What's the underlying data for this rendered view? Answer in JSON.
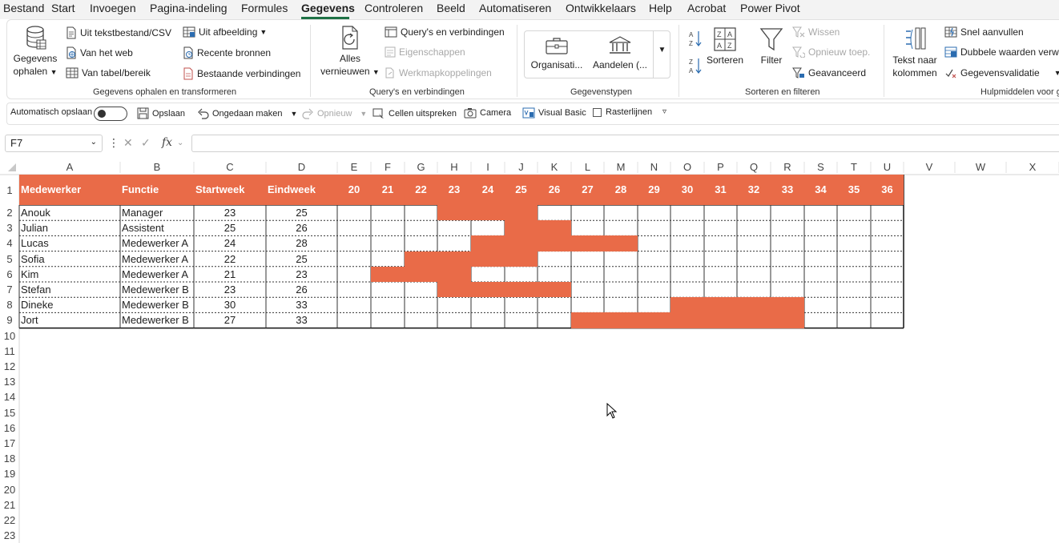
{
  "menu": {
    "tabs": [
      "Bestand",
      "Start",
      "Invoegen",
      "Pagina-indeling",
      "Formules",
      "Gegevens",
      "Controleren",
      "Beeld",
      "Automatiseren",
      "Ontwikkelaars",
      "Help",
      "Acrobat",
      "Power Pivot"
    ],
    "active": "Gegevens"
  },
  "ribbon": {
    "get_data_1": "Gegevens",
    "get_data_2": "ophalen",
    "from_text": "Uit tekstbestand/CSV",
    "from_web": "Van het web",
    "from_table": "Van tabel/bereik",
    "from_picture": "Uit afbeelding",
    "recent_sources": "Recente bronnen",
    "existing_connections": "Bestaande verbindingen",
    "group_get_transform": "Gegevens ophalen en transformeren",
    "refresh_1": "Alles",
    "refresh_2": "vernieuwen",
    "queries_connections": "Query's en verbindingen",
    "properties": "Eigenschappen",
    "workbook_links": "Werkmapkoppelingen",
    "group_queries": "Query's en verbindingen",
    "type_org": "Organisati...",
    "type_stocks": "Aandelen (...",
    "group_types": "Gegevenstypen",
    "sort": "Sorteren",
    "filter": "Filter",
    "clear": "Wissen",
    "reapply": "Opnieuw toep.",
    "advanced": "Geavanceerd",
    "group_sort_filter": "Sorteren en filteren",
    "text_to_columns_1": "Tekst naar",
    "text_to_columns_2": "kolommen",
    "flash_fill": "Snel aanvullen",
    "remove_duplicates": "Dubbele waarden verwi",
    "data_validation": "Gegevensvalidatie",
    "group_tools": "Hulpmiddelen voor g"
  },
  "qat": {
    "autosave": "Automatisch opslaan",
    "save": "Opslaan",
    "undo": "Ongedaan maken",
    "redo": "Opnieuw",
    "speak_cells": "Cellen uitspreken",
    "camera": "Camera",
    "visual_basic": "Visual Basic",
    "gridlines": "Rasterlijnen"
  },
  "formula_bar": {
    "name_box": "F7",
    "formula": ""
  },
  "columns": [
    "A",
    "B",
    "C",
    "D",
    "E",
    "F",
    "G",
    "H",
    "I",
    "J",
    "K",
    "L",
    "M",
    "N",
    "O",
    "P",
    "Q",
    "R",
    "S",
    "T",
    "U",
    "V",
    "W",
    "X"
  ],
  "rows": [
    "1",
    "2",
    "3",
    "4",
    "5",
    "6",
    "7",
    "8",
    "9",
    "10",
    "11",
    "12",
    "13",
    "14",
    "15",
    "16",
    "17",
    "18",
    "19",
    "20",
    "21",
    "22",
    "23"
  ],
  "table": {
    "headers": [
      "Medewerker",
      "Functie",
      "Startweek",
      "Eindweek"
    ],
    "weeks": [
      "20",
      "21",
      "22",
      "23",
      "24",
      "25",
      "26",
      "27",
      "28",
      "29",
      "30",
      "31",
      "32",
      "33",
      "34",
      "35",
      "36"
    ],
    "rows": [
      {
        "name": "Anouk",
        "role": "Manager",
        "start": "23",
        "end": "25"
      },
      {
        "name": "Julian",
        "role": "Assistent",
        "start": "25",
        "end": "26"
      },
      {
        "name": "Lucas",
        "role": "Medewerker A",
        "start": "24",
        "end": "28"
      },
      {
        "name": "Sofia",
        "role": "Medewerker A",
        "start": "22",
        "end": "25"
      },
      {
        "name": "Kim",
        "role": "Medewerker A",
        "start": "21",
        "end": "23"
      },
      {
        "name": "Stefan",
        "role": "Medewerker B",
        "start": "23",
        "end": "26"
      },
      {
        "name": "Dineke",
        "role": "Medewerker B",
        "start": "30",
        "end": "33"
      },
      {
        "name": "Jort",
        "role": "Medewerker B",
        "start": "27",
        "end": "33"
      }
    ]
  },
  "colors": {
    "accent": "#e96b48",
    "ribbon_active": "#1e7145"
  }
}
